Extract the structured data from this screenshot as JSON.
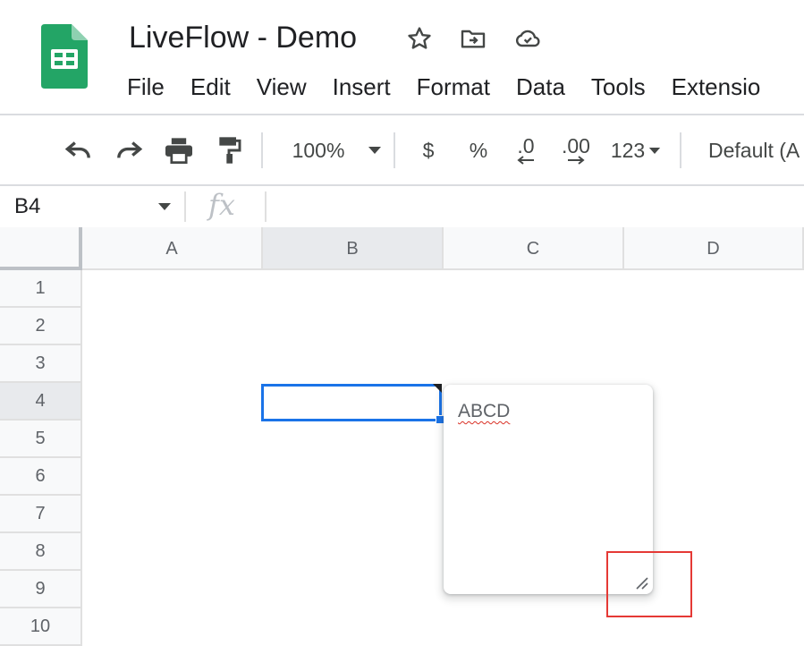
{
  "document": {
    "title": "LiveFlow - Demo"
  },
  "menu": [
    "File",
    "Edit",
    "View",
    "Insert",
    "Format",
    "Data",
    "Tools",
    "Extensio"
  ],
  "toolbar": {
    "zoom": "100%",
    "currency": "$",
    "percent": "%",
    "decrease_decimal": ".0",
    "increase_decimal": ".00",
    "number_format": "123",
    "font": "Default (A"
  },
  "formula_bar": {
    "cell_ref": "B4",
    "fx_label": "fx"
  },
  "grid": {
    "columns": [
      "A",
      "B",
      "C",
      "D"
    ],
    "rows": [
      "1",
      "2",
      "3",
      "4",
      "5",
      "6",
      "7",
      "8",
      "9",
      "10"
    ],
    "active_column": "B",
    "active_row": "4"
  },
  "note": {
    "text": "ABCD"
  },
  "colors": {
    "selection": "#1a73e8",
    "highlight": "#e53935",
    "sheets_green": "#0f9d58"
  }
}
